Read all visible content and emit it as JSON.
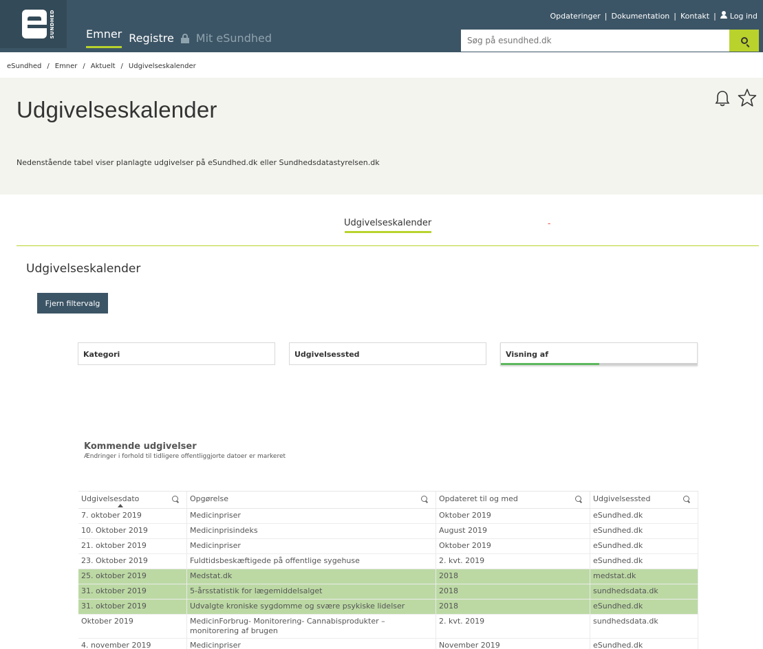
{
  "header": {
    "logo_text": "SUNDHED",
    "nav": [
      "Emner",
      "Registre",
      "Mit eSundhed"
    ],
    "toplinks": [
      "Opdateringer",
      "Dokumentation",
      "Kontakt",
      "Log ind"
    ],
    "search_placeholder": "Søg på esundhed.dk"
  },
  "breadcrumb": [
    "eSundhed",
    "Emner",
    "Aktuelt",
    "Udgivelseskalender"
  ],
  "hero": {
    "title": "Udgivelseskalender",
    "description": "Nedenstående tabel viser planlagte udgivelser på eSundhed.dk eller Sundhedsdatastyrelsen.dk"
  },
  "tabs": {
    "active": "Udgivelseskalender",
    "other": "-"
  },
  "section": {
    "title": "Udgivelseskalender",
    "clear_button": "Fjern filtervalg"
  },
  "filters": [
    {
      "label": "Kategori"
    },
    {
      "label": "Udgivelsessted"
    },
    {
      "label": "Visning af",
      "progress": 0.5
    }
  ],
  "upcoming": {
    "title": "Kommende udgivelser",
    "subtitle": "Ændringer i forhold til tidligere offentliggjorte datoer er markeret"
  },
  "table": {
    "columns": [
      "Udgivelsesdato",
      "Opgørelse",
      "Opdateret til og med",
      "Udgivelsessted"
    ],
    "rows": [
      {
        "cells": [
          "7. oktober 2019",
          "Medicinpriser",
          "Oktober 2019",
          "eSundhed.dk"
        ],
        "highlight": false
      },
      {
        "cells": [
          "10. Oktober 2019",
          "Medicinprisindeks",
          "August 2019",
          "eSundhed.dk"
        ],
        "highlight": false
      },
      {
        "cells": [
          "21. oktober 2019",
          "Medicinpriser",
          "Oktober 2019",
          "eSundhed.dk"
        ],
        "highlight": false
      },
      {
        "cells": [
          "23. Oktober 2019",
          "Fuldtidsbeskæftigede på offentlige sygehuse",
          "2. kvt. 2019",
          "eSundhed.dk"
        ],
        "highlight": false
      },
      {
        "cells": [
          "25. oktober 2019",
          "Medstat.dk",
          "2018",
          "medstat.dk"
        ],
        "highlight": true
      },
      {
        "cells": [
          "31. oktober 2019",
          "5-årsstatistik for lægemiddelsalget",
          "2018",
          "sundhedsdata.dk"
        ],
        "highlight": true
      },
      {
        "cells": [
          "31. oktober 2019",
          "Udvalgte kroniske sygdomme og svære psykiske lidelser",
          "2018",
          "eSundhed.dk"
        ],
        "highlight": true
      },
      {
        "cells": [
          "Oktober 2019",
          "MedicinForbrug- Monitorering- Cannabisprodukter – monitorering af brugen",
          "2. kvt. 2019",
          "sundhedsdata.dk"
        ],
        "highlight": false
      },
      {
        "cells": [
          "4. november 2019",
          "Medicinpriser",
          "November 2019",
          "eSundhed.dk"
        ],
        "highlight": false
      }
    ]
  },
  "colors": {
    "header_bg": "#3c5566",
    "accent": "#b9d22c",
    "highlight_row": "#bcd9a4"
  }
}
